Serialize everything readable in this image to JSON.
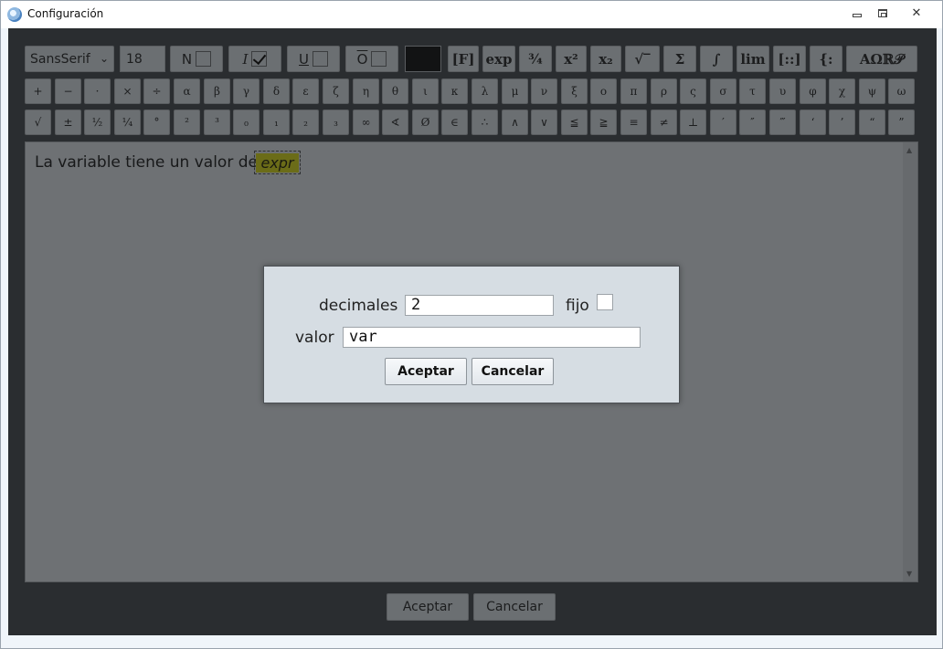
{
  "window": {
    "title": "Configuración",
    "minimize_icon": "minimize-icon",
    "maximize_icon": "restore-icon",
    "close_glyph": "✕"
  },
  "toolbar": {
    "font_family": "SansSerif",
    "font_size": "18",
    "bold_label": "N",
    "bold_checked": false,
    "italic_label": "I",
    "italic_checked": true,
    "underline_label": "U",
    "underline_checked": false,
    "overline_label": "O",
    "overline_checked": false,
    "color_value": "#121314",
    "formula_buttons": [
      "[F]",
      "exp",
      "¾",
      "x²",
      "x₂",
      "√‾",
      "Σ",
      "∫",
      "lim",
      "[::]",
      "{:",
      "AΩℝ𝒫"
    ],
    "row2_symbols": [
      "+",
      "−",
      "·",
      "×",
      "÷",
      "α",
      "β",
      "γ",
      "δ",
      "ε",
      "ζ",
      "η",
      "θ",
      "ι",
      "κ",
      "λ",
      "μ",
      "ν",
      "ξ",
      "ο",
      "π",
      "ρ",
      "ς",
      "σ",
      "τ",
      "υ",
      "φ",
      "χ",
      "ψ",
      "ω"
    ],
    "row3_symbols": [
      "√",
      "±",
      "½",
      "¼",
      "°",
      "²",
      "³",
      "₀",
      "₁",
      "₂",
      "₃",
      "∞",
      "∢",
      "Ø",
      "∈",
      "∴",
      "∧",
      "∨",
      "≦",
      "≧",
      "≡",
      "≠",
      "⊥",
      "′",
      "″",
      "‴",
      "‘",
      "’",
      "“",
      "”"
    ]
  },
  "editor": {
    "text": "La variable tiene un valor de:",
    "chip_text": "expr"
  },
  "footer": {
    "accept_label": "Aceptar",
    "cancel_label": "Cancelar"
  },
  "dialog": {
    "decimals_label": "decimales",
    "decimals_value": "2",
    "fixed_label": "fijo",
    "fixed_checked": false,
    "value_label": "valor",
    "value_value": "var",
    "accept_label": "Aceptar",
    "cancel_label": "Cancelar"
  }
}
